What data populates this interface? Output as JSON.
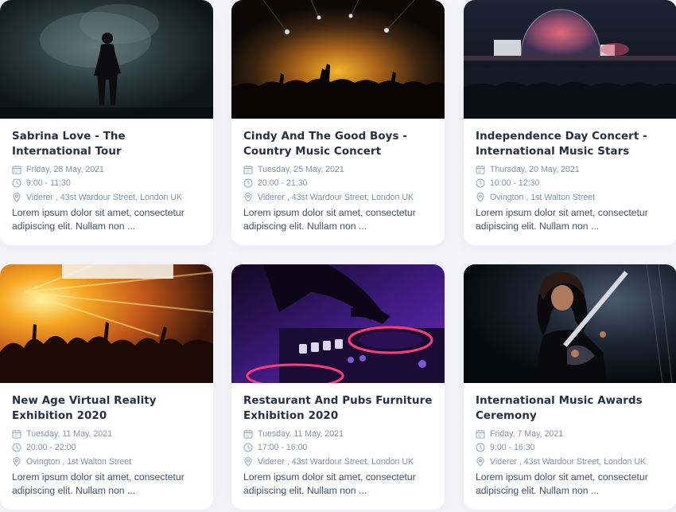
{
  "events": [
    {
      "title": "Sabrina Love - The International Tour",
      "date": "Friday, 28 May, 2021",
      "time": "9:00 - 11:30",
      "location": "Viderer , 43st Wardour Street, London UK",
      "description": "Lorem ipsum dolor sit amet, consectetur adipiscing elit. Nullam non ...",
      "image": "solo-singer-on-smoky-stage"
    },
    {
      "title": "Cindy And The Good Boys - Country Music Concert",
      "date": "Tuesday, 25 May, 2021",
      "time": "20:00 - 21:30",
      "location": "Viderer , 43st Wardour Street, London UK",
      "description": "Lorem ipsum dolor sit amet, consectetur adipiscing elit. Nullam non ...",
      "image": "crowd-with-golden-stage-lights"
    },
    {
      "title": "Independence Day Concert - International Music Stars",
      "date": "Thursday, 20 May, 2021",
      "time": "10:00 - 12:30",
      "location": "Ovington , 1st Walton Street",
      "description": "Lorem ipsum dolor sit amet, consectetur adipiscing elit. Nullam non ...",
      "image": "outdoor-festival-stage-at-night"
    },
    {
      "title": "New Age Virtual Reality Exhibition 2020",
      "date": "Tuesday, 11 May, 2021",
      "time": "20:00 - 22:00",
      "location": "Ovington , 1st Walton Street",
      "description": "Lorem ipsum dolor sit amet, consectetur adipiscing elit. Nullam non ...",
      "image": "crowd-under-orange-lights"
    },
    {
      "title": "Restaurant And Pubs Furniture Exhibition 2020",
      "date": "Tuesday, 11 May, 2021",
      "time": "17:00 - 16:00",
      "location": "Viderer , 43st Wardour Street, London UK",
      "description": "Lorem ipsum dolor sit amet, consectetur adipiscing elit. Nullam non ...",
      "image": "dj-mixer-purple-neon"
    },
    {
      "title": "International Music Awards Ceremony",
      "date": "Friday, 7 May, 2021",
      "time": "9:00 - 16:30",
      "location": "Viderer , 43st Wardour Street, London UK",
      "description": "Lorem ipsum dolor sit amet, consectetur adipiscing elit. Nullam non ...",
      "image": "guitarist-on-dark-stage"
    }
  ],
  "icons": {
    "date": "calendar-icon",
    "time": "clock-icon",
    "location": "map-pin-icon"
  },
  "colors": {
    "title": "#2b2d42",
    "meta": "#8a8fa8",
    "description": "#4a4d63",
    "background": "#f5f5f9",
    "card": "#ffffff"
  }
}
